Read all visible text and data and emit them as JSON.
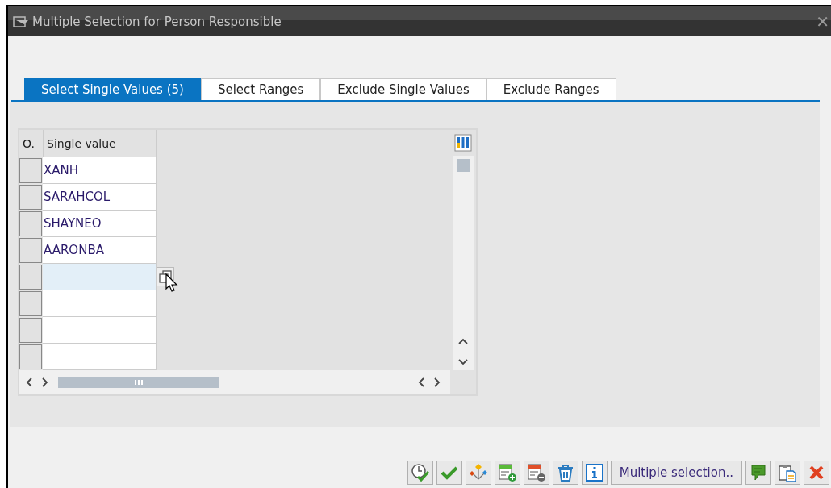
{
  "window": {
    "title": "Multiple Selection for Person Responsible",
    "close": "✕"
  },
  "tabs": [
    {
      "label": "Select Single Values (5)",
      "selected": true
    },
    {
      "label": "Select Ranges",
      "selected": false
    },
    {
      "label": "Exclude Single Values",
      "selected": false
    },
    {
      "label": "Exclude Ranges",
      "selected": false
    }
  ],
  "table": {
    "columns": [
      "O.",
      "Single value"
    ],
    "rows": [
      {
        "value": "XANH",
        "selected": false
      },
      {
        "value": "SARAHCOL",
        "selected": false
      },
      {
        "value": "SHAYNEO",
        "selected": false
      },
      {
        "value": "AARONBA",
        "selected": false
      },
      {
        "selected": true
      },
      {
        "selected": false
      },
      {
        "selected": false
      },
      {
        "selected": false
      }
    ]
  },
  "toolbar": [
    {
      "kind": "execute"
    },
    {
      "kind": "check"
    },
    {
      "kind": "hierarchy"
    },
    {
      "kind": "add-row"
    },
    {
      "kind": "delete-row"
    },
    {
      "kind": "trash"
    },
    {
      "kind": "info"
    },
    {
      "kind": "text",
      "label": "Multiple selection.."
    },
    {
      "kind": "comment"
    },
    {
      "kind": "clipboard"
    },
    {
      "kind": "cancel"
    }
  ]
}
